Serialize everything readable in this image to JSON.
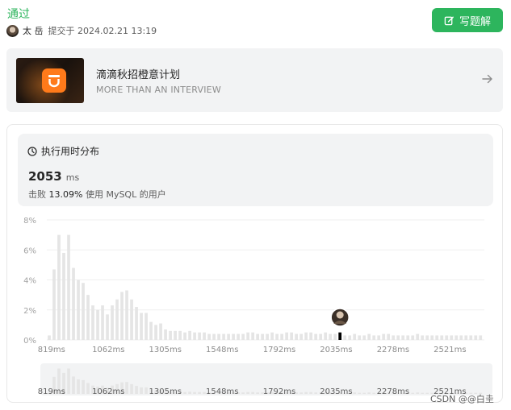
{
  "status": "通过",
  "submitter": {
    "name": "太 岳",
    "submitted_label": "提交于 2024.02.21 13:19",
    "avatar_icon": "user-avatar"
  },
  "actions": {
    "write_solution": "写题解",
    "write_icon": "edit-icon"
  },
  "banner": {
    "title": "滴滴秋招橙意计划",
    "subtitle": "MORE THAN AN INTERVIEW",
    "logo_icon": "didi-logo",
    "arrow_icon": "arrow-right-icon"
  },
  "stats": {
    "header": "执行用时分布",
    "header_icon": "clock-icon",
    "runtime": "2053",
    "unit": "ms",
    "beat_prefix": "击败",
    "beat_value": "13.09%",
    "beat_suffix": "使用 MySQL 的用户"
  },
  "colors": {
    "accent": "#2db55d",
    "bar": "#e5e5e5",
    "marker": "#000000"
  },
  "chart_data": {
    "type": "bar",
    "title": "",
    "xlabel": "",
    "ylabel": "",
    "ylim": [
      0,
      8
    ],
    "y_ticks": [
      "0%",
      "2%",
      "4%",
      "6%",
      "8%"
    ],
    "x_ticks": [
      "819ms",
      "1062ms",
      "1305ms",
      "1548ms",
      "1792ms",
      "2035ms",
      "2278ms",
      "2521ms"
    ],
    "x_tick_values": [
      819,
      1062,
      1305,
      1548,
      1792,
      2035,
      2278,
      2521
    ],
    "x_range": [
      799,
      2668
    ],
    "bin_width": 20.7,
    "values": [
      0.3,
      4.7,
      7.0,
      5.8,
      7.0,
      4.8,
      4.0,
      3.8,
      3.0,
      2.3,
      2.0,
      2.3,
      1.7,
      2.3,
      2.7,
      3.2,
      3.3,
      2.7,
      2.2,
      1.8,
      1.8,
      1.2,
      1.0,
      1.1,
      0.7,
      0.6,
      0.6,
      0.6,
      0.5,
      0.6,
      0.5,
      0.5,
      0.5,
      0.4,
      0.4,
      0.4,
      0.4,
      0.4,
      0.4,
      0.4,
      0.4,
      0.5,
      0.5,
      0.4,
      0.4,
      0.4,
      0.5,
      0.4,
      0.4,
      0.5,
      0.5,
      0.4,
      0.4,
      0.5,
      0.5,
      0.4,
      0.4,
      0.5,
      0.4,
      0.4,
      0.4,
      0.3,
      0.3,
      0.4,
      0.3,
      0.3,
      0.4,
      0.3,
      0.3,
      0.4,
      0.4,
      0.3,
      0.3,
      0.3,
      0.3,
      0.3,
      0.4,
      0.3,
      0.3,
      0.3,
      0.3,
      0.3,
      0.3,
      0.3,
      0.3,
      0.3,
      0.3,
      0.3,
      0.3,
      0.3
    ],
    "highlight_x": 2053,
    "highlight_value": 0.5,
    "grid": true
  },
  "watermark": "CSDN @@白圭"
}
